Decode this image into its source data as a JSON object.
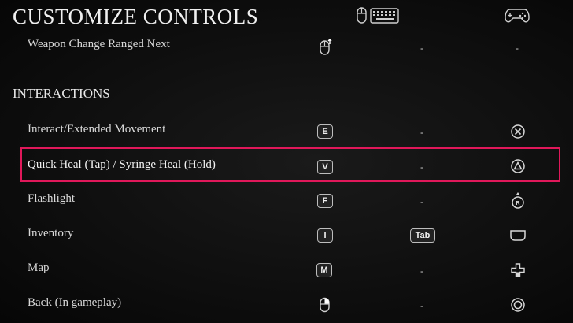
{
  "title": "CUSTOMIZE CONTROLS",
  "header_icons": {
    "keyboard_mouse": "mouse-keyboard-icon",
    "gamepad": "gamepad-icon"
  },
  "top_row": {
    "label": "Weapon Change Ranged Next",
    "primary_icon": "mouse-scroll-up-icon",
    "secondary": "-",
    "pad": "-"
  },
  "section": "INTERACTIONS",
  "rows": [
    {
      "label": "Interact/Extended Movement",
      "key": "E",
      "secondary": "-",
      "pad_icon": "cross-button-icon"
    },
    {
      "label": "Quick Heal (Tap) / Syringe Heal (Hold)",
      "key": "V",
      "secondary": "-",
      "pad_icon": "triangle-button-icon"
    },
    {
      "label": "Flashlight",
      "key": "F",
      "secondary": "-",
      "pad_icon": "right-stick-press-icon"
    },
    {
      "label": "Inventory",
      "key": "I",
      "secondary": "Tab",
      "pad_icon": "touchpad-icon"
    },
    {
      "label": "Map",
      "key": "M",
      "secondary": "-",
      "pad_icon": "dpad-icon"
    },
    {
      "label": "Back (In gameplay)",
      "key_icon": "mouse-right-click-icon",
      "secondary": "-",
      "pad_icon": "circle-button-icon"
    }
  ],
  "colors": {
    "highlight": "#e0185a",
    "background": "#0b0b0b",
    "text": "#d8d8d8"
  },
  "selected_row": 1
}
